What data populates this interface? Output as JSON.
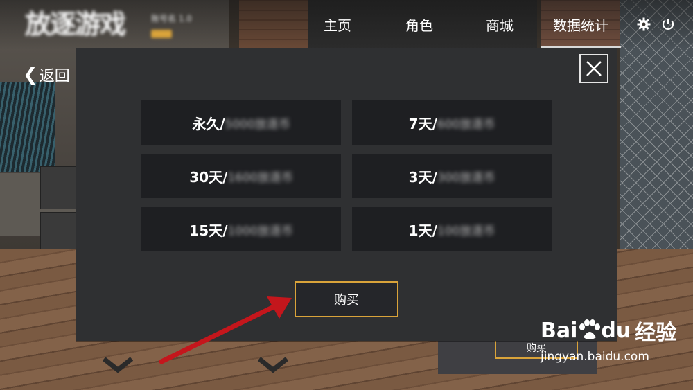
{
  "header": {
    "logo_text": "放逐游戏",
    "user_name": "账号名 1.0",
    "nav": [
      {
        "label": "主页"
      },
      {
        "label": "角色"
      },
      {
        "label": "商城"
      },
      {
        "label": "数据统计",
        "active": true
      }
    ],
    "settings_icon": "gear-icon",
    "power_icon": "power-icon"
  },
  "back": {
    "label": "返回"
  },
  "modal": {
    "close_icon": "close-icon",
    "options": [
      {
        "duration": "永久/",
        "price": "5000放逐币"
      },
      {
        "duration": "7天/",
        "price": "600放逐币"
      },
      {
        "duration": "30天/",
        "price": "1600放逐币"
      },
      {
        "duration": "3天/",
        "price": "300放逐币"
      },
      {
        "duration": "15天/",
        "price": "1000放逐币"
      },
      {
        "duration": "1天/",
        "price": "100放逐币"
      }
    ],
    "buy_label": "购买"
  },
  "background": {
    "card_button_label": "购买"
  },
  "watermark": {
    "brand": "Bai",
    "brand2": "du",
    "cn": "经验",
    "url": "jingyan.baidu.com"
  },
  "colors": {
    "accent": "#d9a33a",
    "modal_bg": "#2f3032",
    "option_bg": "#1e1f22",
    "arrow": "#c4161c"
  }
}
